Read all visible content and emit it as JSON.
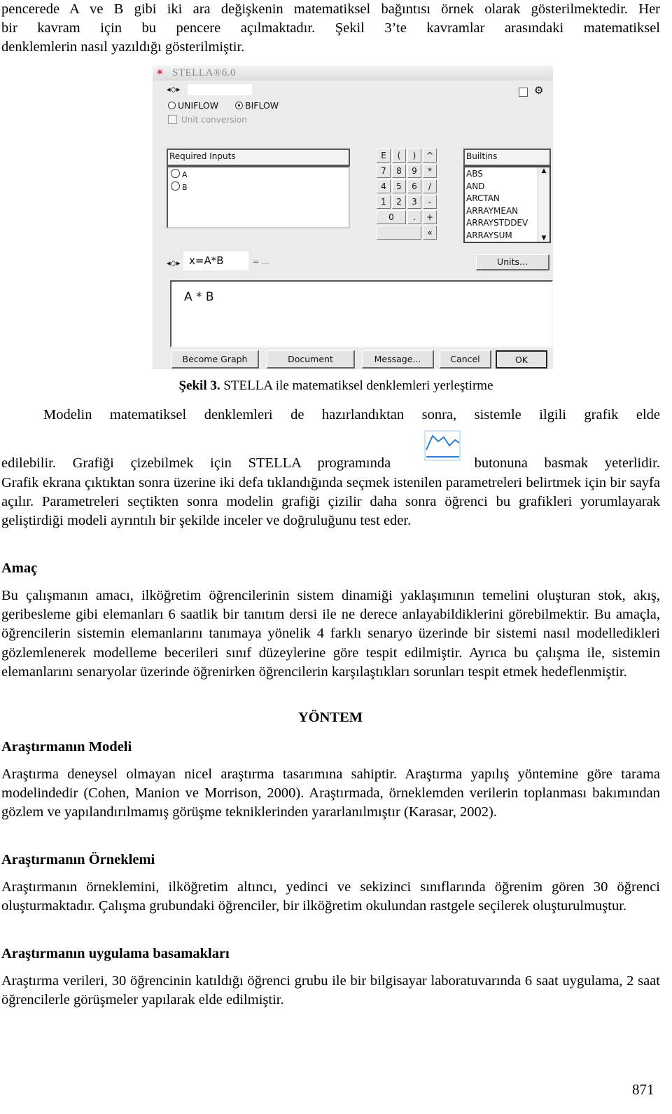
{
  "intro_lines": [
    "pencerede A ve B gibi iki ara değişkenin matematiksel bağıntısı örnek olarak gösterilmektedir. Her",
    "bir kavram için bu pencere açılmaktadır. Şekil 3’te kavramlar arasındaki matematiksel",
    "denklemlerin nasıl yazıldığı gösterilmiştir."
  ],
  "figure": {
    "window_title": "STELLA®6.0",
    "radio_uniflow": "UNIFLOW",
    "radio_biflow": "BIFLOW",
    "selected_flow": "BIFLOW",
    "unit_conversion": "Unit conversion",
    "required_inputs_header": "Required Inputs",
    "required_inputs": [
      "A",
      "B"
    ],
    "keypad": [
      [
        "E",
        "(",
        ")",
        "^"
      ],
      [
        "7",
        "8",
        "9",
        "*"
      ],
      [
        "4",
        "5",
        "6",
        "/"
      ],
      [
        "1",
        "2",
        "3",
        "-"
      ],
      [
        "0",
        ".",
        "+"
      ],
      [
        "",
        "«"
      ]
    ],
    "builtins_header": "Builtins",
    "builtins": [
      "ABS",
      "AND",
      "ARCTAN",
      "ARRAYMEAN",
      "ARRAYSTDDEV",
      "ARRAYSUM"
    ],
    "variable_name": "x=A*B",
    "equals_text": "= ...",
    "units_button": "Units...",
    "equation": "A * B",
    "buttons": {
      "become_graph": "Become Graph",
      "document": "Document",
      "message": "Message...",
      "cancel": "Cancel",
      "ok": "OK"
    }
  },
  "caption": {
    "label": "Şekil 3.",
    "text": " STELLA ile matematiksel denklemleri yerleştirme"
  },
  "para_graph": {
    "line1": "Modelin matematiksel denklemleri de hazırlandıktan sonra, sistemle ilgili grafik elde",
    "line2_before": "edilebilir. Grafiği çizebilmek için STELLA programında",
    "line2_after": "butonuna basmak yeterlidir.",
    "rest": "Grafik ekrana çıktıktan sonra üzerine iki defa tıklandığında seçmek istenilen parametreleri belirtmek için bir sayfa açılır. Parametreleri seçtikten sonra modelin grafiği çizilir daha sonra öğrenci bu grafikleri yorumlayarak geliştirdiği modeli ayrıntılı bir şekilde inceler ve doğruluğunu test eder."
  },
  "amac": {
    "heading": "Amaç",
    "text": "Bu çalışmanın amacı, ilköğretim öğrencilerinin sistem dinamiği yaklaşımının temelini oluşturan stok, akış, geribesleme gibi elemanları 6 saatlik bir tanıtım dersi ile ne derece anlayabildiklerini görebilmektir. Bu amaçla, öğrencilerin sistemin elemanlarını tanımaya yönelik 4 farklı senaryo üzerinde bir sistemi nasıl modelledikleri gözlemlenerek modelleme becerileri sınıf düzeylerine göre tespit edilmiştir. Ayrıca bu çalışma ile, sistemin elemanlarını senaryolar üzerinde öğrenirken öğrencilerin karşılaştıkları sorunları tespit etmek hedeflenmiştir."
  },
  "yontem": "YÖNTEM",
  "model": {
    "heading": "Araştırmanın Modeli",
    "text": "Araştırma deneysel olmayan nicel araştırma tasarımına sahiptir. Araştırma yapılış yöntemine göre tarama modelindedir (Cohen, Manion ve Morrison, 2000). Araştırmada, örneklemden verilerin toplanması bakımından gözlem ve yapılandırılmamış görüşme tekniklerinden yararlanılmıştır (Karasar, 2002)."
  },
  "orneklem": {
    "heading": "Araştırmanın Örneklemi",
    "text": "Araştırmanın örneklemini, ilköğretim altıncı, yedinci ve sekizinci sınıflarında öğrenim gören 30 öğrenci oluşturmaktadır. Çalışma grubundaki öğrenciler, bir ilköğretim okulundan rastgele seçilerek oluşturulmuştur."
  },
  "uygulama": {
    "heading": "Araştırmanın uygulama basamakları",
    "text": "Araştırma verileri, 30 öğrencinin katıldığı öğrenci grubu ile bir bilgisayar laboratuvarında 6 saat uygulama, 2 saat öğrencilerle görüşmeler yapılarak elde edilmiştir."
  },
  "page_number": "871",
  "graph_icon_color": "#2f7fd0"
}
